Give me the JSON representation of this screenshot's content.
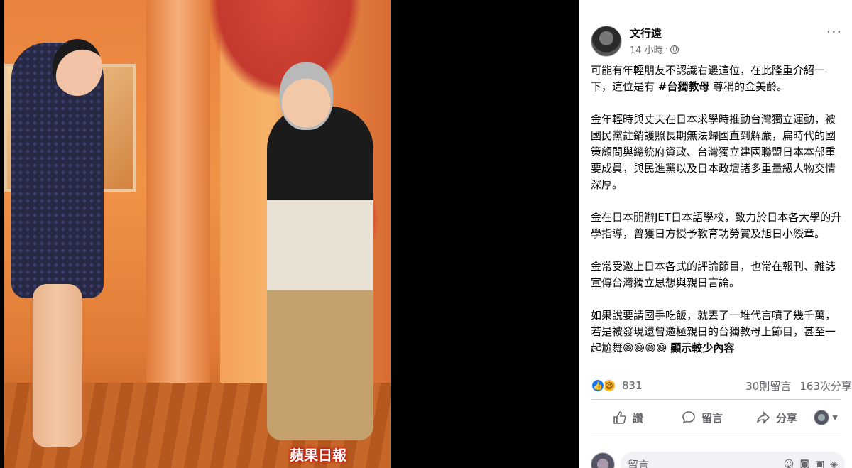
{
  "photo": {
    "watermark": "蘋果日報"
  },
  "post": {
    "author": "文行遠",
    "time": "14 小時",
    "paragraphs": [
      {
        "before": "可能有年輕朋友不認識右邊這位，在此隆重介紹一下，這位是有 ",
        "hashtag": "#台獨教母",
        "after": " 尊稱的金美齡。"
      },
      {
        "text": "金年輕時與丈夫在日本求學時推動台灣獨立運動，被國民黨註銷護照長期無法歸國直到解嚴，扁時代的國策顧問與總統府資政、台灣獨立建國聯盟日本本部重要成員，與民進黨以及日本政壇諸多重量級人物交情深厚。"
      },
      {
        "text": "金在日本開辦JET日本語學校，致力於日本各大學的升學指導，曾獲日方授予教育功勞賞及旭日小綬章。"
      },
      {
        "text": "金常受邀上日本各式的評論節目，也常在報刊、雜誌宣傳台灣獨立思想與親日言論。"
      },
      {
        "text": "如果說要請國手吃飯，就丟了一堆代言噴了幾千萬，若是被發現還曾邀極親日的台獨教母上節目，甚至一起尬舞😄😄😄😄 "
      }
    ],
    "see_more": "顯示較少內容",
    "reaction_count": "831",
    "comments_count": "30則留言",
    "shares_count": "163次分享",
    "actions": {
      "like": "讚",
      "comment": "留言",
      "share": "分享"
    },
    "comment_placeholder": "留言"
  },
  "colors": {
    "like_blue": "#1877f2",
    "haha_yellow": "#f7b125",
    "secondary_text": "#65676b"
  }
}
